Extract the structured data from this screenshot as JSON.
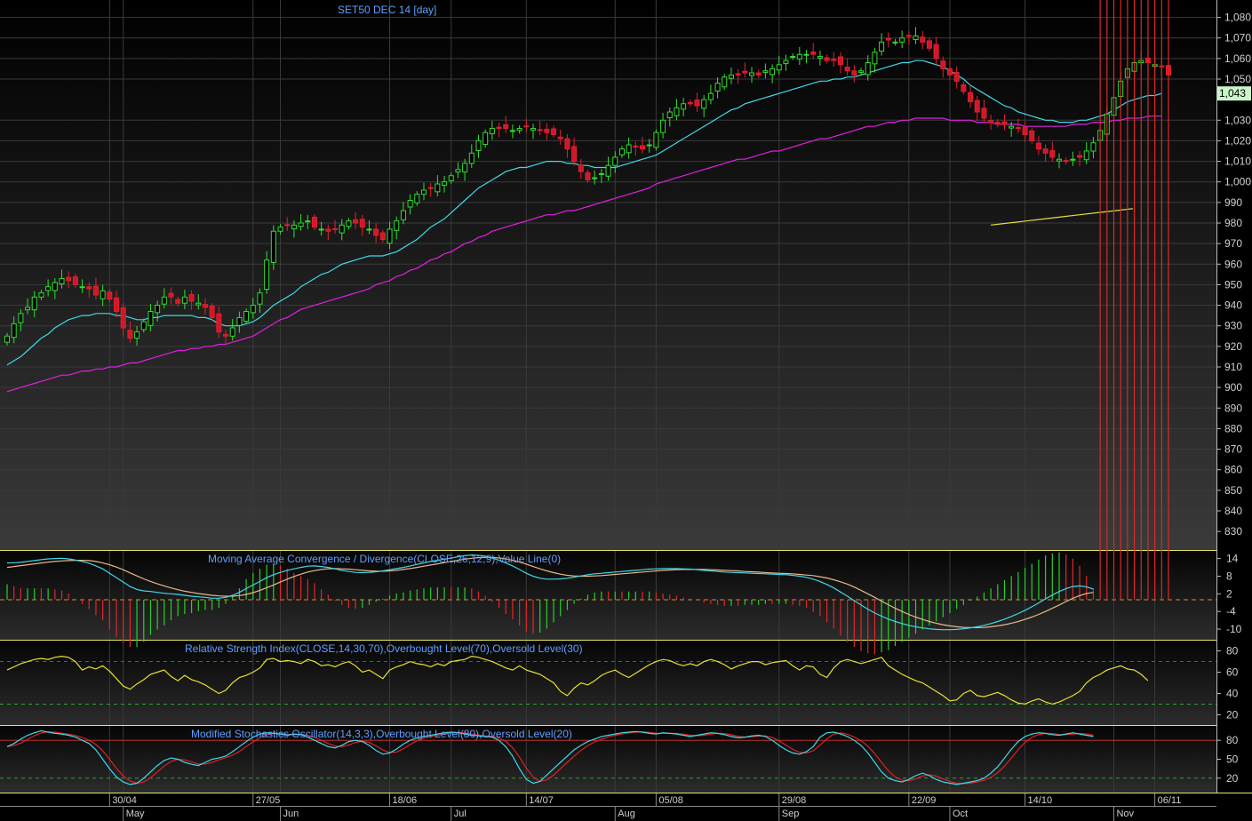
{
  "chart_data": [
    {
      "type": "candlestick",
      "title": "SET50 DEC 14   [day]",
      "last_price_label": "1,043",
      "y_ticks": [
        "1,080",
        "1,070",
        "1,060",
        "1,050",
        "1,043",
        "1,030",
        "1,020",
        "1,010",
        "1,000",
        "990",
        "980",
        "970",
        "960",
        "950",
        "940",
        "930",
        "920",
        "910",
        "900",
        "890",
        "880",
        "870",
        "860",
        "850",
        "840",
        "830"
      ],
      "y_tick_values": [
        1080,
        1070,
        1060,
        1050,
        1043,
        1030,
        1020,
        1010,
        1000,
        990,
        980,
        970,
        960,
        950,
        940,
        930,
        920,
        910,
        900,
        890,
        880,
        870,
        860,
        850,
        840,
        830
      ],
      "ylim": [
        824,
        1085
      ],
      "grid": true,
      "x_dates": [
        "30/04",
        "27/05",
        "18/06",
        "14/07",
        "05/08",
        "29/08",
        "22/09",
        "14/10",
        "06/11"
      ],
      "x_months": [
        "May",
        "Jun",
        "Jul",
        "Aug",
        "Sep",
        "Oct",
        "Nov"
      ],
      "close": [
        925,
        931,
        936,
        939,
        944,
        946,
        949,
        951,
        953,
        952,
        950,
        949,
        948,
        945,
        947,
        943,
        937,
        929,
        924,
        927,
        932,
        937,
        940,
        944,
        944,
        941,
        944,
        942,
        941,
        939,
        934,
        927,
        925,
        929,
        934,
        937,
        940,
        946,
        962,
        976,
        978,
        979,
        979,
        980,
        981,
        978,
        977,
        976,
        977,
        979,
        981,
        980,
        978,
        977,
        974,
        972,
        977,
        981,
        986,
        991,
        994,
        996,
        997,
        999,
        1000,
        1003,
        1006,
        1009,
        1014,
        1020,
        1024,
        1026,
        1026,
        1026,
        1025,
        1026,
        1027,
        1026,
        1025,
        1024,
        1023,
        1021,
        1016,
        1010,
        1005,
        1001,
        1002,
        1004,
        1008,
        1012,
        1016,
        1018,
        1017,
        1016,
        1018,
        1024,
        1030,
        1034,
        1036,
        1038,
        1038,
        1037,
        1040,
        1043,
        1048,
        1051,
        1052,
        1052,
        1053,
        1053,
        1052,
        1054,
        1055,
        1057,
        1059,
        1061,
        1062,
        1062,
        1062,
        1061,
        1059,
        1059,
        1057,
        1054,
        1052,
        1054,
        1058,
        1063,
        1068,
        1069,
        1068,
        1070,
        1071,
        1071,
        1068,
        1065,
        1060,
        1055,
        1052,
        1049,
        1044,
        1039,
        1034,
        1031,
        1029,
        1028,
        1028,
        1027,
        1026,
        1023,
        1020,
        1016,
        1014,
        1012,
        1011,
        1010,
        1011,
        1012,
        1015,
        1019,
        1025,
        1033,
        1041,
        1049,
        1055,
        1058,
        1059,
        1058,
        1057,
        1056,
        1052
      ],
      "sma_fast": [
        911,
        913,
        915,
        918,
        921,
        924,
        926,
        929,
        931,
        933,
        934,
        935,
        935,
        936,
        936,
        936,
        935,
        935,
        934,
        933,
        933,
        934,
        934,
        935,
        935,
        935,
        935,
        935,
        934,
        934,
        933,
        931,
        930,
        930,
        930,
        931,
        932,
        934,
        937,
        940,
        942,
        944,
        946,
        949,
        951,
        953,
        955,
        956,
        958,
        960,
        961,
        962,
        963,
        964,
        964,
        964,
        965,
        966,
        968,
        970,
        972,
        975,
        978,
        980,
        982,
        985,
        988,
        991,
        994,
        997,
        999,
        1001,
        1003,
        1005,
        1006,
        1007,
        1007,
        1008,
        1009,
        1010,
        1010,
        1010,
        1009,
        1009,
        1008,
        1008,
        1007,
        1007,
        1007,
        1007,
        1008,
        1009,
        1010,
        1011,
        1012,
        1013,
        1015,
        1017,
        1019,
        1021,
        1023,
        1025,
        1027,
        1029,
        1031,
        1033,
        1035,
        1036,
        1038,
        1039,
        1040,
        1041,
        1042,
        1043,
        1044,
        1045,
        1046,
        1047,
        1048,
        1049,
        1049,
        1050,
        1050,
        1051,
        1051,
        1052,
        1053,
        1054,
        1055,
        1056,
        1057,
        1058,
        1058,
        1059,
        1059,
        1058,
        1057,
        1056,
        1054,
        1052,
        1050,
        1047,
        1045,
        1043,
        1041,
        1039,
        1037,
        1036,
        1034,
        1033,
        1032,
        1031,
        1030,
        1030,
        1029,
        1029,
        1029,
        1030,
        1030,
        1031,
        1032,
        1033,
        1035,
        1037,
        1039,
        1040,
        1041,
        1042,
        1042,
        1043
      ],
      "sma_slow": [
        898,
        899,
        900,
        901,
        902,
        903,
        904,
        905,
        906,
        906,
        907,
        908,
        908,
        909,
        909,
        910,
        910,
        911,
        912,
        912,
        913,
        914,
        915,
        916,
        917,
        918,
        918,
        919,
        919,
        920,
        920,
        921,
        921,
        922,
        923,
        924,
        925,
        927,
        929,
        931,
        933,
        934,
        936,
        938,
        939,
        940,
        941,
        942,
        943,
        944,
        945,
        946,
        947,
        948,
        950,
        951,
        952,
        954,
        955,
        957,
        958,
        960,
        962,
        963,
        965,
        966,
        968,
        970,
        971,
        973,
        974,
        976,
        977,
        978,
        979,
        980,
        981,
        982,
        983,
        984,
        984,
        985,
        986,
        986,
        987,
        988,
        989,
        990,
        991,
        992,
        993,
        994,
        995,
        996,
        997,
        999,
        1000,
        1001,
        1002,
        1003,
        1004,
        1005,
        1006,
        1007,
        1008,
        1009,
        1010,
        1011,
        1011,
        1012,
        1013,
        1014,
        1015,
        1015,
        1016,
        1017,
        1018,
        1019,
        1020,
        1021,
        1021,
        1022,
        1023,
        1024,
        1025,
        1026,
        1027,
        1027,
        1028,
        1029,
        1029,
        1030,
        1030,
        1031,
        1031,
        1031,
        1031,
        1031,
        1030,
        1030,
        1030,
        1030,
        1029,
        1029,
        1029,
        1028,
        1028,
        1028,
        1028,
        1027,
        1027,
        1027,
        1027,
        1027,
        1027,
        1027,
        1028,
        1028,
        1028,
        1029,
        1029,
        1029,
        1030,
        1030,
        1031,
        1031,
        1031,
        1032,
        1032,
        1032
      ],
      "sma_long_segment": [
        979,
        980,
        981,
        982,
        983,
        984,
        985,
        986,
        987
      ]
    },
    {
      "type": "line",
      "title": "Moving Average Convergence / Divergence(CLOSE,26,12,9),Value Line(0)",
      "y_ticks": [
        "14",
        "8",
        "2",
        "-4",
        "-10"
      ],
      "y_tick_values": [
        14,
        8,
        2,
        -4,
        -10
      ],
      "ylim": [
        -13,
        16
      ],
      "macd": [
        12.5,
        12.6,
        12.7,
        13.0,
        13.3,
        13.6,
        13.9,
        14.0,
        14.1,
        13.9,
        13.5,
        13.0,
        12.4,
        11.5,
        10.5,
        9.0,
        7.5,
        6.0,
        4.5,
        3.5,
        3.0,
        2.8,
        2.5,
        2.2,
        2.0,
        1.8,
        1.5,
        1.2,
        1.0,
        0.8,
        0.5,
        0.5,
        0.8,
        1.5,
        2.5,
        3.8,
        5.0,
        6.2,
        7.5,
        8.5,
        9.3,
        10.0,
        10.5,
        11.0,
        11.4,
        11.5,
        11.3,
        11.0,
        10.5,
        10.0,
        9.6,
        9.3,
        9.2,
        9.3,
        9.5,
        9.8,
        10.2,
        10.6,
        11.0,
        11.5,
        12.0,
        12.5,
        13.0,
        13.4,
        13.8,
        14.2,
        14.6,
        15.0,
        15.2,
        15.1,
        14.8,
        14.2,
        13.4,
        12.5,
        11.5,
        10.3,
        9.0,
        8.0,
        7.3,
        7.0,
        7.0,
        7.1,
        7.3,
        7.7,
        8.1,
        8.5,
        8.8,
        9.0,
        9.2,
        9.4,
        9.6,
        9.8,
        10.0,
        10.2,
        10.4,
        10.5,
        10.6,
        10.6,
        10.6,
        10.5,
        10.4,
        10.2,
        10.0,
        9.8,
        9.6,
        9.4,
        9.3,
        9.2,
        9.1,
        9.0,
        8.9,
        8.8,
        8.7,
        8.6,
        8.5,
        8.3,
        8.0,
        7.6,
        7.0,
        6.2,
        5.2,
        4.0,
        2.6,
        1.2,
        -0.3,
        -1.8,
        -3.2,
        -4.5,
        -5.6,
        -6.6,
        -7.4,
        -8.1,
        -8.7,
        -9.2,
        -9.6,
        -9.9,
        -10.1,
        -10.2,
        -10.2,
        -10.1,
        -9.9,
        -9.6,
        -9.2,
        -8.7,
        -8.1,
        -7.4,
        -6.6,
        -5.7,
        -4.7,
        -3.6,
        -2.4,
        -1.1,
        0.3,
        1.6,
        2.8,
        3.8,
        4.5,
        4.7,
        4.4,
        3.6
      ],
      "signal": [
        11.0,
        11.3,
        11.6,
        11.9,
        12.2,
        12.5,
        12.8,
        13.0,
        13.2,
        13.3,
        13.4,
        13.4,
        13.3,
        13.0,
        12.5,
        11.9,
        11.1,
        10.2,
        9.1,
        8.1,
        7.1,
        6.2,
        5.4,
        4.7,
        4.0,
        3.4,
        2.9,
        2.5,
        2.1,
        1.8,
        1.5,
        1.3,
        1.2,
        1.2,
        1.4,
        1.8,
        2.4,
        3.2,
        4.1,
        5.0,
        6.0,
        7.0,
        7.9,
        8.7,
        9.4,
        9.9,
        10.3,
        10.5,
        10.6,
        10.5,
        10.4,
        10.2,
        10.0,
        9.8,
        9.7,
        9.7,
        9.8,
        10.0,
        10.3,
        10.6,
        11.0,
        11.4,
        11.8,
        12.2,
        12.6,
        13.0,
        13.4,
        13.8,
        14.1,
        14.3,
        14.4,
        14.4,
        14.2,
        13.9,
        13.4,
        12.8,
        12.1,
        11.3,
        10.5,
        9.8,
        9.2,
        8.7,
        8.3,
        8.1,
        8.0,
        8.0,
        8.1,
        8.2,
        8.4,
        8.6,
        8.8,
        9.0,
        9.2,
        9.4,
        9.6,
        9.8,
        10.0,
        10.1,
        10.2,
        10.3,
        10.3,
        10.3,
        10.3,
        10.2,
        10.1,
        10.0,
        9.9,
        9.8,
        9.6,
        9.5,
        9.4,
        9.2,
        9.1,
        9.0,
        8.9,
        8.8,
        8.6,
        8.4,
        8.2,
        7.8,
        7.4,
        6.8,
        6.1,
        5.3,
        4.3,
        3.2,
        2.0,
        0.8,
        -0.5,
        -1.7,
        -2.9,
        -4.0,
        -5.0,
        -5.9,
        -6.7,
        -7.4,
        -8.0,
        -8.5,
        -8.9,
        -9.2,
        -9.4,
        -9.5,
        -9.5,
        -9.4,
        -9.2,
        -8.9,
        -8.5,
        -8.0,
        -7.4,
        -6.7,
        -5.9,
        -5.0,
        -4.0,
        -2.9,
        -1.8,
        -0.6,
        0.5,
        1.4,
        2.1,
        2.5
      ]
    },
    {
      "type": "line",
      "title": "Relative Strength Index(CLOSE,14,30,70),Overbought Level(70),Oversold Level(30)",
      "y_ticks": [
        "80",
        "60",
        "40",
        "20"
      ],
      "y_tick_values": [
        80,
        60,
        40,
        20
      ],
      "ylim": [
        12,
        88
      ],
      "overbought": 70,
      "oversold": 30,
      "rsi": [
        62,
        65,
        68,
        70,
        72,
        73,
        72,
        74,
        75,
        74,
        70,
        62,
        65,
        63,
        66,
        61,
        54,
        47,
        44,
        49,
        53,
        58,
        60,
        62,
        56,
        52,
        57,
        53,
        51,
        48,
        44,
        40,
        43,
        50,
        55,
        57,
        60,
        64,
        72,
        73,
        70,
        71,
        70,
        68,
        72,
        70,
        66,
        67,
        65,
        68,
        70,
        66,
        60,
        62,
        58,
        54,
        62,
        65,
        67,
        70,
        68,
        67,
        65,
        68,
        66,
        70,
        71,
        72,
        75,
        74,
        72,
        70,
        67,
        64,
        62,
        66,
        62,
        60,
        58,
        54,
        50,
        42,
        38,
        45,
        50,
        48,
        52,
        57,
        60,
        62,
        58,
        55,
        59,
        63,
        67,
        70,
        72,
        71,
        68,
        66,
        68,
        66,
        70,
        72,
        70,
        67,
        63,
        66,
        68,
        70,
        70,
        67,
        69,
        70,
        71,
        66,
        62,
        66,
        65,
        58,
        55,
        64,
        70,
        72,
        70,
        68,
        70,
        72,
        74,
        66,
        62,
        58,
        55,
        52,
        50,
        46,
        42,
        38,
        33,
        34,
        40,
        43,
        38,
        37,
        39,
        41,
        38,
        34,
        31,
        30,
        33,
        35,
        32,
        30,
        32,
        35,
        38,
        42,
        50,
        55,
        58,
        62,
        64,
        66,
        63,
        62,
        58,
        52
      ]
    },
    {
      "type": "line",
      "title": "Modified Stochastics Oscillator(14,3,3),Overbought Level(80),Oversold Level(20)",
      "y_ticks": [
        "80",
        "50",
        "20"
      ],
      "y_tick_values": [
        80,
        50,
        20
      ],
      "ylim": [
        0,
        100
      ],
      "overbought": 80,
      "oversold": 20,
      "k": [
        70,
        75,
        82,
        88,
        92,
        95,
        93,
        91,
        90,
        88,
        85,
        80,
        75,
        65,
        50,
        35,
        22,
        14,
        10,
        12,
        20,
        30,
        40,
        48,
        52,
        50,
        45,
        42,
        40,
        45,
        50,
        52,
        55,
        62,
        70,
        78,
        85,
        90,
        92,
        91,
        90,
        88,
        90,
        89,
        85,
        80,
        75,
        70,
        68,
        72,
        78,
        80,
        78,
        72,
        64,
        58,
        60,
        66,
        74,
        80,
        84,
        86,
        88,
        90,
        92,
        93,
        92,
        90,
        88,
        87,
        86,
        85,
        80,
        70,
        55,
        35,
        18,
        12,
        15,
        25,
        35,
        45,
        55,
        65,
        72,
        78,
        82,
        86,
        88,
        90,
        92,
        93,
        94,
        93,
        91,
        90,
        92,
        91,
        90,
        88,
        86,
        88,
        90,
        92,
        91,
        89,
        86,
        84,
        85,
        87,
        88,
        86,
        80,
        72,
        65,
        60,
        58,
        62,
        70,
        85,
        92,
        93,
        90,
        86,
        80,
        72,
        60,
        45,
        30,
        20,
        16,
        14,
        18,
        24,
        28,
        24,
        18,
        14,
        12,
        10,
        12,
        14,
        16,
        20,
        28,
        38,
        52,
        66,
        78,
        86,
        90,
        92,
        91,
        89,
        88,
        90,
        92,
        90,
        88,
        86
      ]
    }
  ]
}
